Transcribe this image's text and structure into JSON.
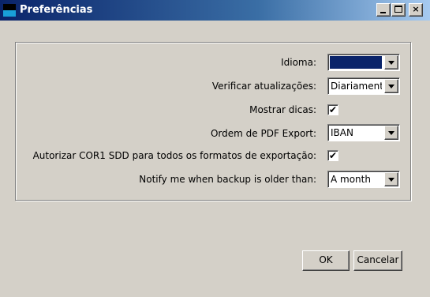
{
  "window": {
    "title": "Preferências",
    "controls": {
      "minimize": "minimize-icon",
      "maximize": "maximize-icon",
      "close": "×"
    }
  },
  "preferences": {
    "idioma": {
      "label": "Idioma:",
      "value": ""
    },
    "verificar": {
      "label": "Verificar atualizações:",
      "value": "Diariamente"
    },
    "dicas": {
      "label": "Mostrar dicas:",
      "checked": true,
      "mark": "✔"
    },
    "ordem": {
      "label": "Ordem de PDF Export:",
      "value": "IBAN"
    },
    "autorizar": {
      "label": "Autorizar COR1 SDD para todos os formatos de exportação:",
      "checked": true,
      "mark": "✔"
    },
    "notify": {
      "label": "Notify me when backup is older than:",
      "value": "A month"
    }
  },
  "buttons": {
    "ok": "OK",
    "cancel": "Cancelar"
  },
  "colors": {
    "title_start": "#0a246a",
    "title_end": "#a6caf0",
    "face": "#d4d0c8",
    "selection": "#0a246a"
  }
}
